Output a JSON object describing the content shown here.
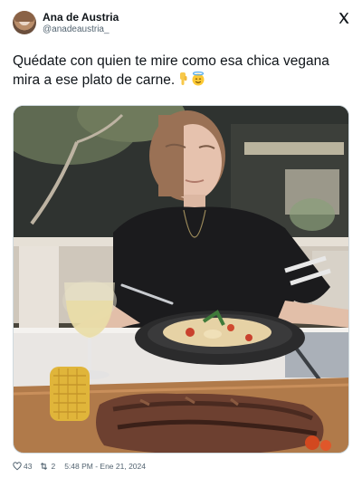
{
  "tweet": {
    "author_name": "Ana de Austria",
    "author_handle": "@anadeaustria_",
    "text": "Quédate con quien te mire como esa chica vegana mira a ese plato de carne.",
    "emojis": [
      "pointing-down-hand-emoji",
      "smiling-face-with-halo-emoji"
    ],
    "likes": "43",
    "retweets": "2",
    "timestamp": "5:48 PM - Ene 21, 2024"
  },
  "icons": {
    "brand": "x-logo-icon",
    "like": "heart-icon",
    "retweet": "retweet-icon"
  },
  "colors": {
    "text": "#0f1419",
    "secondary": "#536471",
    "border": "#cfd9de"
  }
}
